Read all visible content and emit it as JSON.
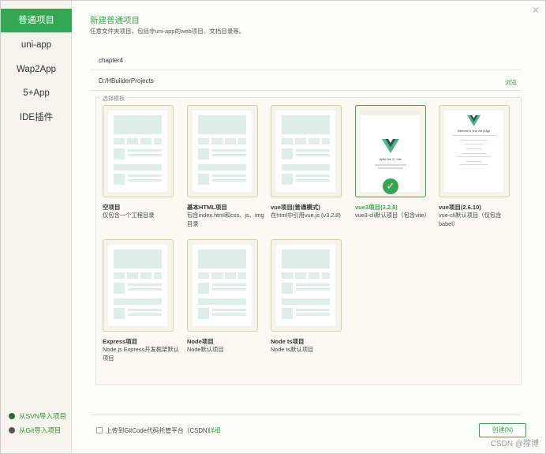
{
  "sidebar": {
    "items": [
      {
        "label": "普通项目",
        "active": true
      },
      {
        "label": "uni-app"
      },
      {
        "label": "Wap2App"
      },
      {
        "label": "5+App"
      },
      {
        "label": "IDE插件"
      }
    ],
    "import_svn": "从SVN导入项目",
    "import_git": "从Git导入项目"
  },
  "header": {
    "title": "新建普通项目",
    "subtitle": "任意文件夹项目，包括非uni-app的web项目、文档目录等。"
  },
  "form": {
    "project_name": "chapter4",
    "location": "D:/HBuilderProjects",
    "browse_label": "浏览"
  },
  "templates": {
    "group_label": "选择模板",
    "items": [
      {
        "title": "空项目",
        "desc": "仅包含一个工程目录"
      },
      {
        "title": "基本HTML项目",
        "desc": "包含index.html和css、js、img目录"
      },
      {
        "title": "vue项目(普通模式)",
        "desc": "在html中引用vue.js (v3.2.8)"
      },
      {
        "title": "vue3项目(3.2.8)",
        "desc": "vue3-cli默认项目（包含vite）",
        "selected": true,
        "preview_text": "HyBit Vue 3 + Vite"
      },
      {
        "title": "vue项目(2.6.10)",
        "desc": "vue-cli默认项目（仅包含babel）",
        "preview_text": "Welcome to Your Vue.js App"
      },
      {
        "title": "Express项目",
        "desc": "Node.js Express开发框架默认项目"
      },
      {
        "title": "Node项目",
        "desc": "Node默认项目"
      },
      {
        "title": "Node ts项目",
        "desc": "Node ts默认项目"
      }
    ]
  },
  "footer": {
    "upload_label": "上传到GitCode代码托管平台（CSDN）",
    "detail_label": "详细",
    "create_label": "创建(N)"
  },
  "watermark": "CSDN @撑博",
  "colors": {
    "accent": "#3aa34f",
    "sidebar_active": "#32a852",
    "thumb_border": "#d6cfa6",
    "block": "#dfeee9"
  }
}
